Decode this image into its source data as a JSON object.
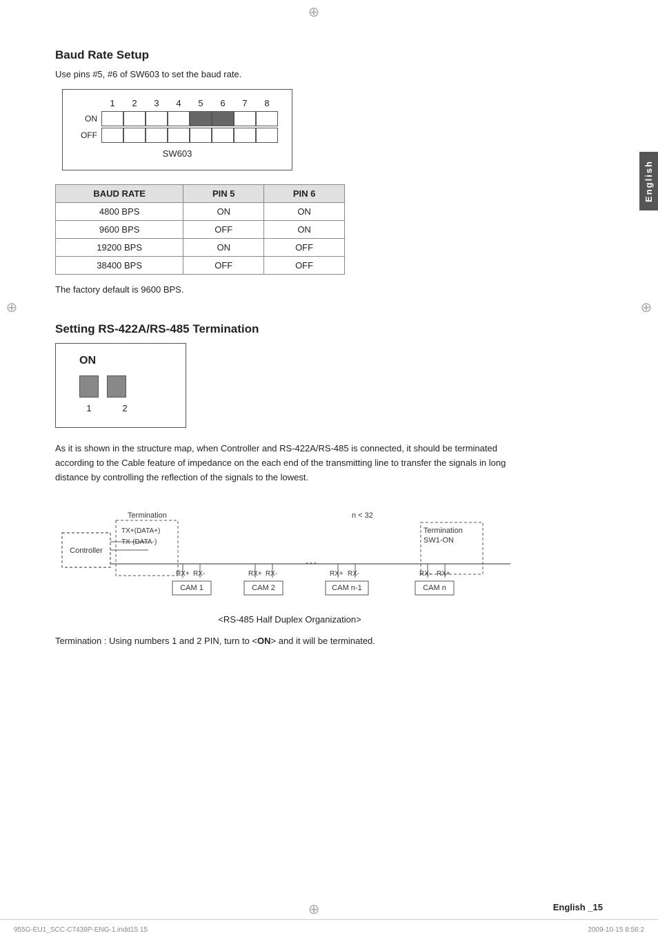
{
  "page": {
    "sidebar_label": "English",
    "footer_left": "955G-EU1_SCC-C7439P-ENG-1.indd15   15",
    "footer_right": "2009-10-15   8:56:2",
    "page_number": "English _15"
  },
  "baud_rate_setup": {
    "title": "Baud Rate Setup",
    "subtitle": "Use pins #5, #6 of SW603 to set the baud rate.",
    "sw603_label": "SW603",
    "pin_numbers": [
      "1",
      "2",
      "3",
      "4",
      "5",
      "6",
      "7",
      "8"
    ],
    "on_label": "ON",
    "off_label": "OFF",
    "table_headers": [
      "BAUD RATE",
      "PIN 5",
      "PIN 6"
    ],
    "table_rows": [
      [
        "4800 BPS",
        "ON",
        "ON"
      ],
      [
        "9600 BPS",
        "OFF",
        "ON"
      ],
      [
        "19200 BPS",
        "ON",
        "OFF"
      ],
      [
        "38400 BPS",
        "OFF",
        "OFF"
      ]
    ],
    "factory_default": "The factory default is 9600 BPS."
  },
  "rs422_termination": {
    "title": "Setting RS-422A/RS-485 Termination",
    "on_label": "ON",
    "pin1_label": "1",
    "pin2_label": "2",
    "description": "As it is shown in the structure map, when Controller and RS-422A/RS-485 is connected, it should be terminated according to the Cable feature of impedance on the each end of the transmitting line to transfer the signals in long distance by controlling the reflection of the signals to the lowest.",
    "diagram": {
      "n_label": "n < 32",
      "controller_label": "Controller",
      "termination_label": "Termination",
      "tx_data_plus": "TX+(DATA+)",
      "tx_data_minus": "TX-(DATA-)",
      "termination_sw": "Termination\nSW1-ON",
      "cam_labels": [
        "CAM 1",
        "CAM 2",
        "CAM n-1",
        "CAM n"
      ],
      "rx_labels": [
        "RX+",
        "RX-",
        "RX+",
        "RX-",
        "RX+",
        "RX-",
        "RX-",
        "RX+"
      ],
      "caption": "<RS-485 Half Duplex Organization>"
    },
    "termination_note": "Termination : Using numbers 1 and 2 PIN, turn to <ON> and it will be terminated."
  }
}
